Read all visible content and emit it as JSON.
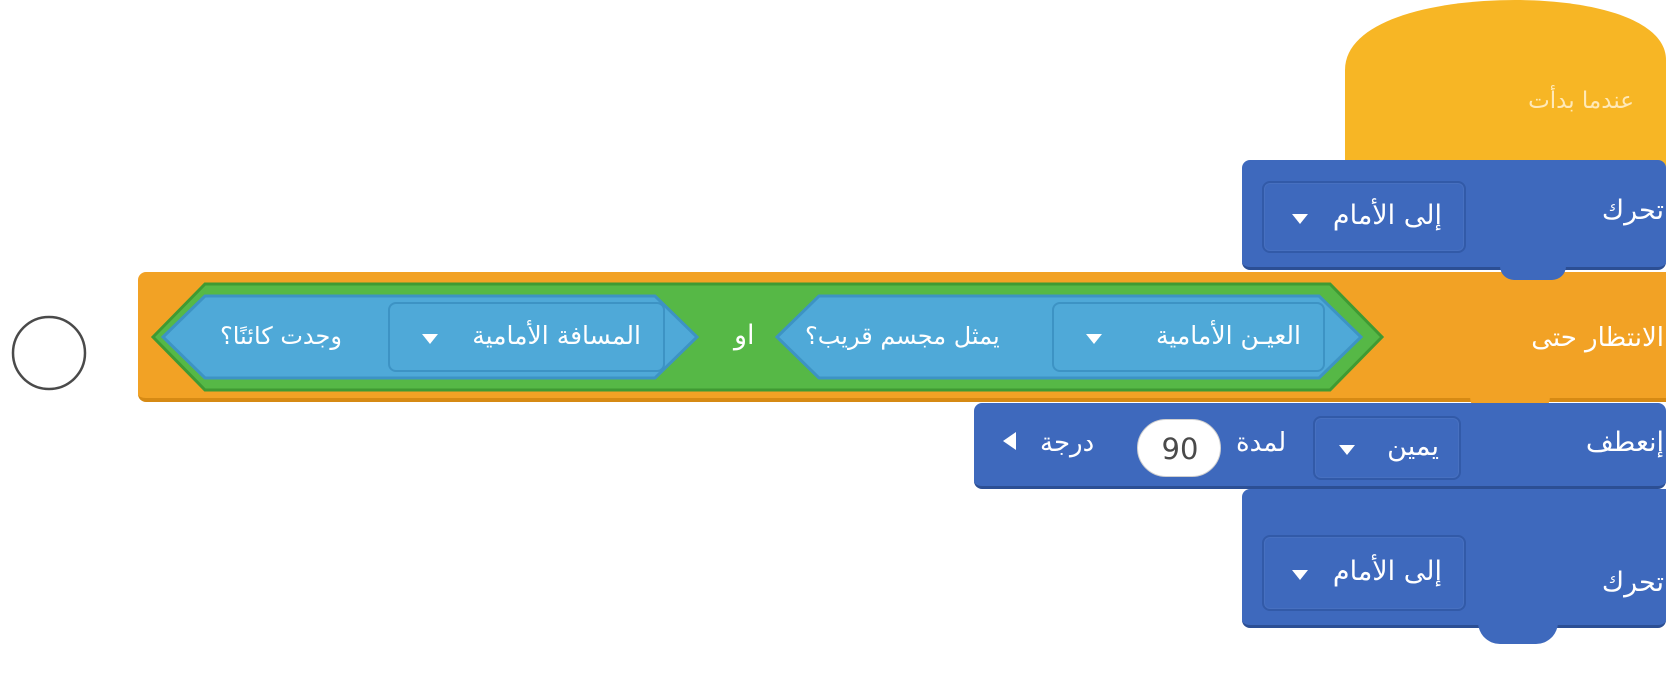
{
  "blocks": {
    "hat": {
      "label": "عندما بدأت",
      "color": "#f7b625"
    },
    "move1": {
      "label": "تحرك",
      "direction": "إلى الأمام",
      "color": "#3e69bd"
    },
    "wait_until": {
      "label": "الانتظار حتى",
      "color": "#f2a225",
      "or_label": "او",
      "condition_left": {
        "sensor": "العيـن الأمامية",
        "text": "يمثل مجسم قريب؟"
      },
      "condition_right": {
        "sensor": "المسافة الأمامية",
        "text": "وجدت كائنًا؟"
      }
    },
    "turn": {
      "label": "إنعطف",
      "direction": "يمين",
      "for_label": "لمدة",
      "value": "90",
      "unit": "درجة"
    },
    "move2": {
      "label": "تحرك",
      "direction": "إلى الأمام"
    }
  },
  "colors": {
    "event": "#f7b625",
    "control": "#f2a225",
    "motion": "#3e69bd",
    "or_operator": "#56b846",
    "sensing": "#4fa9d8"
  },
  "icons": {
    "empty_circle": "circle-outline-icon",
    "dropdown": "caret-down-icon",
    "rotate": "caret-left-icon"
  }
}
